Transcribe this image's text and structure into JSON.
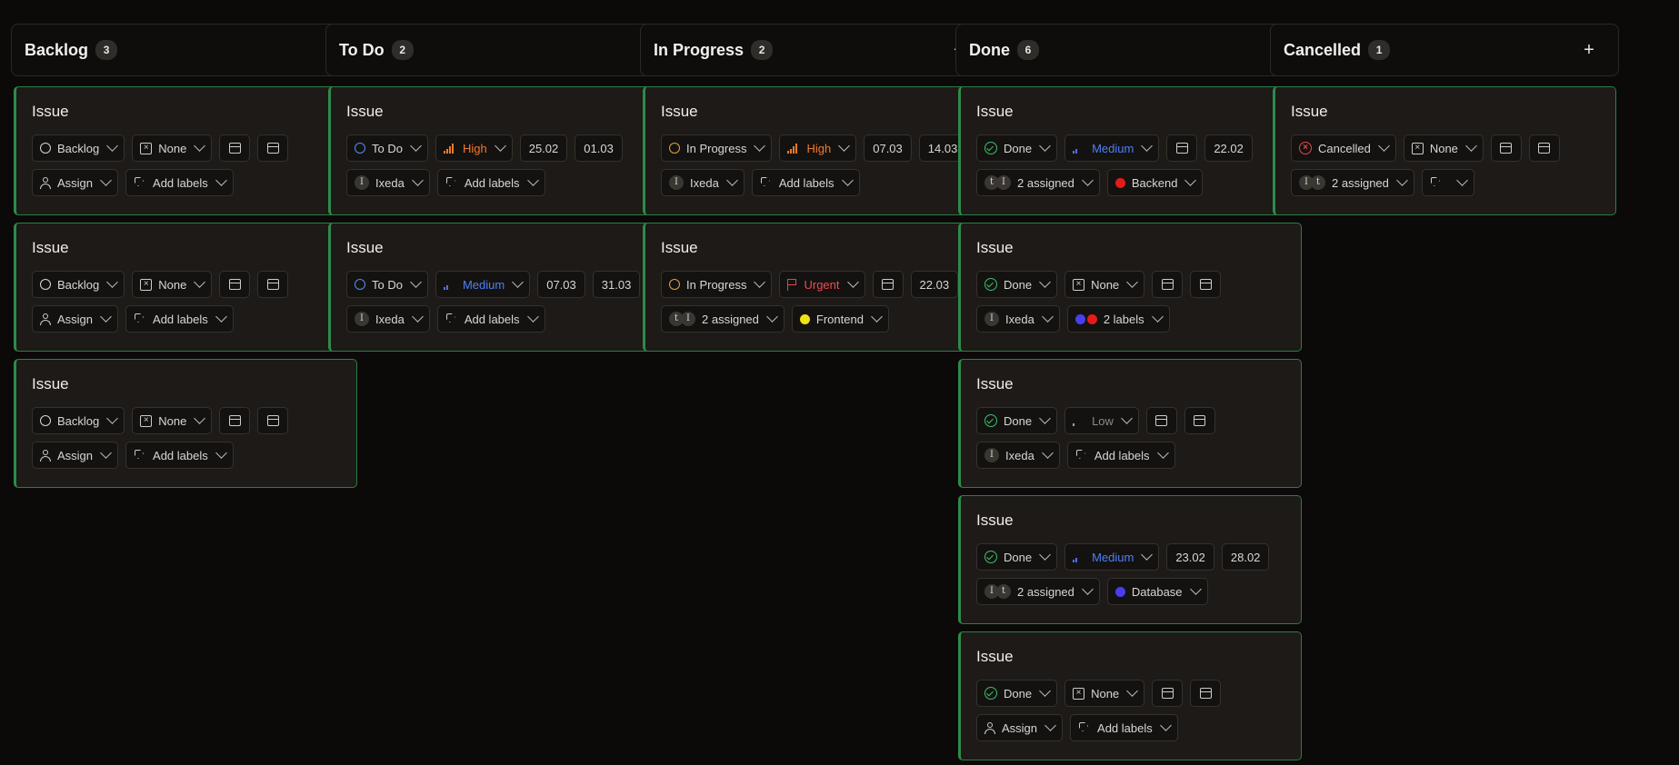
{
  "columns": [
    {
      "title": "Backlog",
      "count": "3",
      "cards": [
        {
          "title": "Issue",
          "status": {
            "label": "Backlog",
            "icon": "circle-icon"
          },
          "priority": {
            "label": "None",
            "icon": "x-box-icon"
          },
          "start": "",
          "due": "",
          "assign": {
            "label": "Assign",
            "icon": "user-icon"
          },
          "labels": {
            "label": "Add labels",
            "icon": "tag-icon"
          }
        },
        {
          "title": "Issue",
          "status": {
            "label": "Backlog",
            "icon": "circle-icon"
          },
          "priority": {
            "label": "None",
            "icon": "x-box-icon"
          },
          "start": "",
          "due": "",
          "assign": {
            "label": "Assign",
            "icon": "user-icon"
          },
          "labels": {
            "label": "Add labels",
            "icon": "tag-icon"
          }
        },
        {
          "title": "Issue",
          "status": {
            "label": "Backlog",
            "icon": "circle-icon"
          },
          "priority": {
            "label": "None",
            "icon": "x-box-icon"
          },
          "start": "",
          "due": "",
          "assign": {
            "label": "Assign",
            "icon": "user-icon"
          },
          "labels": {
            "label": "Add labels",
            "icon": "tag-icon"
          }
        }
      ]
    },
    {
      "title": "To Do",
      "count": "2",
      "cards": [
        {
          "title": "Issue",
          "status": {
            "label": "To Do",
            "icon": "circle-blue-icon"
          },
          "priority": {
            "label": "High",
            "icon": "bars-high-icon"
          },
          "start": "25.02",
          "due": "01.03",
          "assign": {
            "label": "Ixeda",
            "avatars": [
              "I"
            ]
          },
          "labels": {
            "label": "Add labels",
            "icon": "tag-icon"
          }
        },
        {
          "title": "Issue",
          "status": {
            "label": "To Do",
            "icon": "circle-blue-icon"
          },
          "priority": {
            "label": "Medium",
            "icon": "bars-medium-icon"
          },
          "start": "07.03",
          "due": "31.03",
          "assign": {
            "label": "Ixeda",
            "avatars": [
              "I"
            ]
          },
          "labels": {
            "label": "Add labels",
            "icon": "tag-icon"
          }
        }
      ]
    },
    {
      "title": "In Progress",
      "count": "2",
      "cards": [
        {
          "title": "Issue",
          "status": {
            "label": "In Progress",
            "icon": "circle-orange-icon"
          },
          "priority": {
            "label": "High",
            "icon": "bars-high-icon"
          },
          "start": "07.03",
          "due": "14.03",
          "assign": {
            "label": "Ixeda",
            "avatars": [
              "I"
            ]
          },
          "labels": {
            "label": "Add labels",
            "icon": "tag-icon"
          }
        },
        {
          "title": "Issue",
          "status": {
            "label": "In Progress",
            "icon": "circle-orange-icon"
          },
          "priority": {
            "label": "Urgent",
            "icon": "flag-icon"
          },
          "start": "",
          "due": "22.03",
          "assign": {
            "label": "2 assigned",
            "avatars": [
              "t",
              "I"
            ]
          },
          "labels": {
            "label": "Frontend",
            "dots": [
              "#f2e10f"
            ]
          }
        }
      ]
    },
    {
      "title": "Done",
      "count": "6",
      "cards": [
        {
          "title": "Issue",
          "status": {
            "label": "Done",
            "icon": "check-circle-icon"
          },
          "priority": {
            "label": "Medium",
            "icon": "bars-medium-icon"
          },
          "start": "",
          "due": "22.02",
          "assign": {
            "label": "2 assigned",
            "avatars": [
              "t",
              "I"
            ]
          },
          "labels": {
            "label": "Backend",
            "dots": [
              "#e51b1b"
            ]
          }
        },
        {
          "title": "Issue",
          "status": {
            "label": "Done",
            "icon": "check-circle-icon"
          },
          "priority": {
            "label": "None",
            "icon": "x-box-icon"
          },
          "start": "",
          "due": "",
          "assign": {
            "label": "Ixeda",
            "avatars": [
              "I"
            ]
          },
          "labels": {
            "label": "2 labels",
            "dots": [
              "#4a3ef0",
              "#e51b1b"
            ]
          }
        },
        {
          "title": "Issue",
          "status": {
            "label": "Done",
            "icon": "check-circle-icon"
          },
          "priority": {
            "label": "Low",
            "icon": "bars-low-icon"
          },
          "start": "",
          "due": "",
          "assign": {
            "label": "Ixeda",
            "avatars": [
              "I"
            ]
          },
          "labels": {
            "label": "Add labels",
            "icon": "tag-icon"
          }
        },
        {
          "title": "Issue",
          "status": {
            "label": "Done",
            "icon": "check-circle-icon"
          },
          "priority": {
            "label": "Medium",
            "icon": "bars-medium-icon"
          },
          "start": "23.02",
          "due": "28.02",
          "assign": {
            "label": "2 assigned",
            "avatars": [
              "I",
              "t"
            ]
          },
          "labels": {
            "label": "Database",
            "dots": [
              "#4a3ef0"
            ]
          }
        },
        {
          "title": "Issue",
          "status": {
            "label": "Done",
            "icon": "check-circle-icon"
          },
          "priority": {
            "label": "None",
            "icon": "x-box-icon"
          },
          "start": "",
          "due": "",
          "assign": {
            "label": "Assign",
            "icon": "user-icon"
          },
          "labels": {
            "label": "Add labels",
            "icon": "tag-icon"
          }
        }
      ]
    },
    {
      "title": "Cancelled",
      "count": "1",
      "cards": [
        {
          "title": "Issue",
          "status": {
            "label": "Cancelled",
            "icon": "x-circle-icon"
          },
          "priority": {
            "label": "None",
            "icon": "x-box-icon"
          },
          "start": "",
          "due": "",
          "assign": {
            "label": "2 assigned",
            "avatars": [
              "I",
              "t"
            ]
          },
          "labels": {
            "label": "",
            "icon": "tag-icon"
          }
        }
      ]
    }
  ],
  "colors": {
    "background": "#0b0a09",
    "card": "#1d1a17",
    "card_border": "#2e7d46",
    "high": "#f07a2a",
    "medium": "#4f7ff5",
    "urgent": "#ef4a4f",
    "done": "#3fbf6a"
  }
}
